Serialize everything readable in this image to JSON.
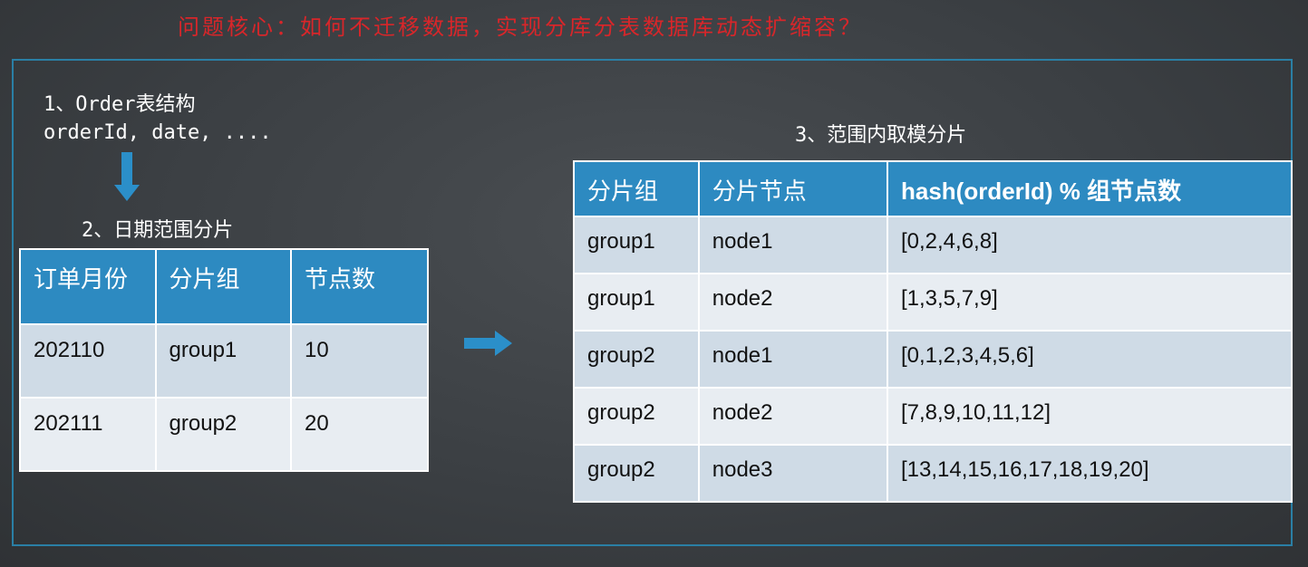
{
  "title": "问题核心：如何不迁移数据，实现分库分表数据库动态扩缩容？",
  "structure": {
    "heading": "1、Order表结构",
    "fields": "orderId, date, ...."
  },
  "date_sharding": {
    "heading": "2、日期范围分片",
    "columns": [
      "订单月份",
      "分片组",
      "节点数"
    ],
    "rows": [
      [
        "202110",
        "group1",
        "10"
      ],
      [
        "202111",
        "group2",
        "20"
      ]
    ]
  },
  "mod_sharding": {
    "heading": "3、范围内取模分片",
    "columns": [
      "分片组",
      "分片节点",
      "hash(orderId) % 组节点数"
    ],
    "rows": [
      [
        "group1",
        "node1",
        "[0,2,4,6,8]"
      ],
      [
        "group1",
        "node2",
        "[1,3,5,7,9]"
      ],
      [
        "group2",
        "node1",
        "[0,1,2,3,4,5,6]"
      ],
      [
        "group2",
        "node2",
        "[7,8,9,10,11,12]"
      ],
      [
        "group2",
        "node3",
        "[13,14,15,16,17,18,19,20]"
      ]
    ]
  },
  "colors": {
    "title": "#d8262a",
    "header": "#2d8ac1",
    "row_odd": "#cfdbe6",
    "row_even": "#e8edf2",
    "frame": "#2a7fa5",
    "arrow": "#2b8fc9"
  },
  "icons": {
    "down_arrow": "arrow-down-icon",
    "right_arrow": "arrow-right-icon"
  }
}
